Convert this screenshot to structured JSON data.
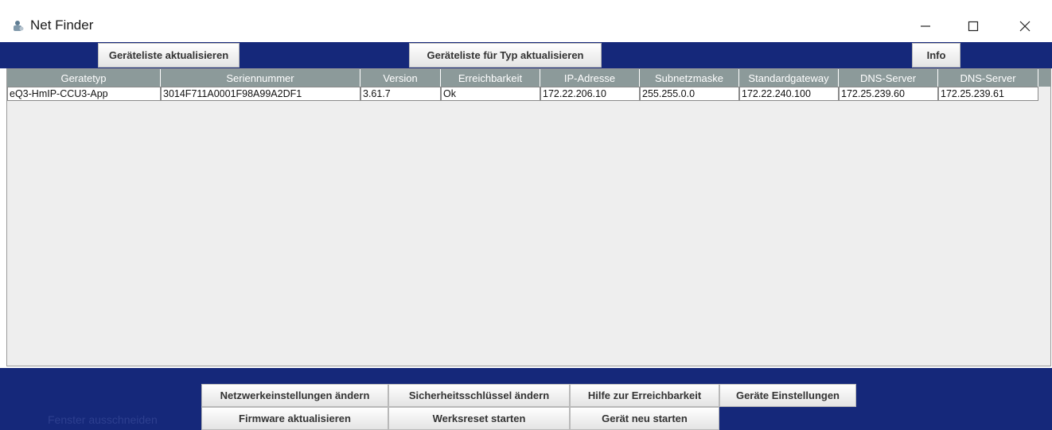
{
  "window": {
    "title": "Net Finder",
    "icon": "network-finder-icon",
    "controls": {
      "minimize": "−",
      "maximize": "☐",
      "close": "✕"
    }
  },
  "toolbar": {
    "refresh_list": "Geräteliste aktualisieren",
    "refresh_by_type": "Geräteliste für Typ aktualisieren",
    "info": "Info"
  },
  "table": {
    "columns": [
      "Geratetyp",
      "Seriennummer",
      "Version",
      "Erreichbarkeit",
      "IP-Adresse",
      "Subnetzmaske",
      "Standardgateway",
      "DNS-Server",
      "DNS-Server"
    ],
    "rows": [
      [
        "eQ3-HmIP-CCU3-App",
        "3014F711A0001F98A99A2DF1",
        "3.61.7",
        "Ok",
        "172.22.206.10",
        "255.255.0.0",
        "172.22.240.100",
        "172.25.239.60",
        "172.25.239.61"
      ]
    ]
  },
  "footer": {
    "network_settings": "Netzwerkeinstellungen ändern",
    "security_key": "Sicherheitsschlüssel ändern",
    "reachability_help": "Hilfe zur Erreichbarkeit",
    "device_settings": "Geräte Einstellungen",
    "firmware_update": "Firmware aktualisieren",
    "factory_reset": "Werksreset starten",
    "restart_device": "Gerät neu starten",
    "hint": "Fenster ausschneiden"
  },
  "colors": {
    "bar_background": "#15287a",
    "header_background": "#8c9a9a",
    "table_background": "#eeeeee"
  }
}
